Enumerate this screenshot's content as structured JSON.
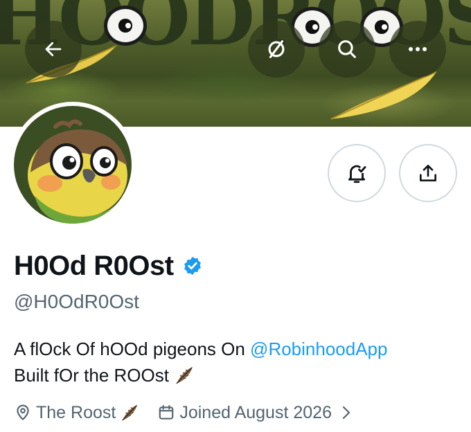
{
  "banner": {
    "text": "HOODROOST",
    "buttons": {
      "back": {
        "icon": "arrow-left-icon"
      },
      "unmute": {
        "icon": "prohibited-circle-icon"
      },
      "search": {
        "icon": "search-icon"
      },
      "more": {
        "icon": "more-horizontal-icon",
        "label": "•••"
      }
    }
  },
  "avatar": {
    "alt": "Cartoon pigeon avatar",
    "description_icon": "pigeon-avatar"
  },
  "actions": {
    "notifications": {
      "icon": "bell-check-icon"
    },
    "share": {
      "icon": "share-upload-icon"
    }
  },
  "profile": {
    "display_name": "H0Od R0Ost",
    "verified_icon": "verified-badge-icon",
    "handle": "@H0OdR0Ost",
    "bio": {
      "line1_text": "A flOck Of hOOd pigeons On ",
      "line1_mention": "@RobinhoodApp",
      "line2_text": "Built fOr the ROOst ",
      "feather_icon": "feather-emoji-icon"
    },
    "location": {
      "icon": "location-pin-icon",
      "text": "The Roost"
    },
    "joined": {
      "icon": "calendar-icon",
      "text": "Joined August 2026",
      "chevron": "chevron-right-icon"
    }
  },
  "colors": {
    "accent": "#1d9bf0",
    "secondary_text": "#536471",
    "primary_text": "#0f1419",
    "border": "#cfd9de",
    "banner_green": "#4f5d2a"
  }
}
